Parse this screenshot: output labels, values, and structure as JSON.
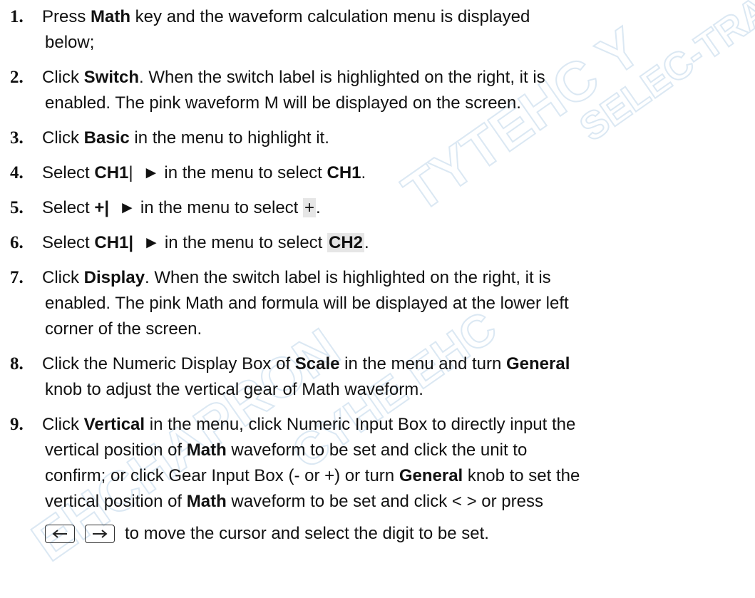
{
  "watermark": {
    "texts": [
      "TYTEHC Y",
      "EHCHAPRON",
      "CYHE EHC",
      "SELEC-TRADE"
    ],
    "color": "#cfe0ef"
  },
  "steps": [
    {
      "num": "1.",
      "parts": [
        {
          "t": "Press "
        },
        {
          "t": "Math",
          "b": true
        },
        {
          "t": " key and the waveform calculation menu is displayed"
        }
      ],
      "lines2": [
        {
          "t": "below;"
        }
      ]
    },
    {
      "num": "2.",
      "parts": [
        {
          "t": "Click "
        },
        {
          "t": "Switch",
          "b": true
        },
        {
          "t": ". When the switch label is highlighted on the right, it is"
        }
      ],
      "lines2": [
        {
          "t": "enabled. The pink waveform M will be displayed on the screen."
        }
      ]
    },
    {
      "num": "3.",
      "parts": [
        {
          "t": "Click "
        },
        {
          "t": "Basic",
          "b": true
        },
        {
          "t": " in the menu to highlight it."
        }
      ]
    },
    {
      "num": "4.",
      "parts": [
        {
          "t": "Select "
        },
        {
          "t": "CH1",
          "b": true
        },
        {
          "t": "|  ► in the menu to select "
        },
        {
          "t": "CH1",
          "b": true
        },
        {
          "t": "."
        }
      ]
    },
    {
      "num": "5.",
      "parts": [
        {
          "t": "Select "
        },
        {
          "t": "+|",
          "b": true
        },
        {
          "t": "  ► in the menu to select "
        },
        {
          "t": "+",
          "hl": true
        },
        {
          "t": "."
        }
      ]
    },
    {
      "num": "6.",
      "parts": [
        {
          "t": "Select "
        },
        {
          "t": "CH1|",
          "b": true
        },
        {
          "t": "  ► in the menu to select "
        },
        {
          "t": "CH2",
          "b": true,
          "hl": true
        },
        {
          "t": "."
        }
      ]
    },
    {
      "num": "7.",
      "parts": [
        {
          "t": "Click "
        },
        {
          "t": "Display",
          "b": true
        },
        {
          "t": ". When the switch label is highlighted on the right, it is"
        }
      ],
      "lines2": [
        {
          "t": "enabled. The pink Math and formula will be displayed at the lower left"
        }
      ],
      "lines3": [
        {
          "t": "corner of the screen."
        }
      ]
    },
    {
      "num": "8.",
      "parts": [
        {
          "t": "Click the Numeric Display Box of "
        },
        {
          "t": "Scale",
          "b": true
        },
        {
          "t": " in the menu and turn "
        },
        {
          "t": "General",
          "b": true
        }
      ],
      "lines2": [
        {
          "t": "knob to adjust the vertical gear of Math waveform."
        }
      ]
    },
    {
      "num": "9.",
      "parts": [
        {
          "t": "Click "
        },
        {
          "t": "Vertical",
          "b": true
        },
        {
          "t": " in the menu, click Numeric Input Box to directly input the"
        }
      ],
      "lines2": [
        {
          "t": "vertical position of "
        },
        {
          "t": "Math",
          "b": true
        },
        {
          "t": " waveform to be set and click the unit to"
        }
      ],
      "lines3": [
        {
          "t": "confirm; or click Gear Input Box (- or +) or turn "
        },
        {
          "t": "General",
          "b": true
        },
        {
          "t": " knob to set the"
        }
      ],
      "lines4": [
        {
          "t": "vertical position of "
        },
        {
          "t": "Math",
          "b": true
        },
        {
          "t": " waveform to be set and click < > or press"
        }
      ],
      "keys": [
        "left-arrow-key",
        "right-arrow-key"
      ],
      "keys_text": "to move the cursor and select the digit to be set."
    }
  ]
}
